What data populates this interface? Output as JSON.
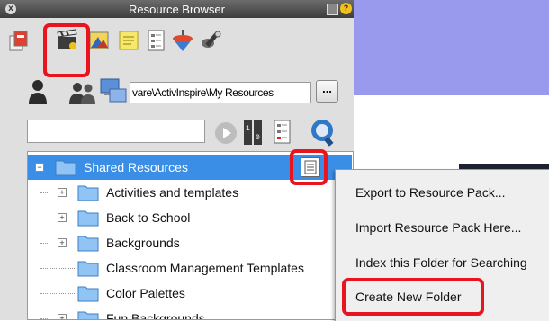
{
  "window": {
    "title": "Resource Browser",
    "close_glyph": "x",
    "help_glyph": "?"
  },
  "colors": {
    "highlight_red": "#e8141e",
    "selection_blue": "#3a8ee6",
    "titlebar": "#4a4a4a",
    "background_purple": "#9999ee"
  },
  "toolbar": {
    "icons": [
      "resources-icon",
      "media-clapboard-icon",
      "backgrounds-icon",
      "notes-icon",
      "document-page-icon",
      "spinning-top-icon",
      "pointer-tools-icon"
    ],
    "selected_icon": "media-clapboard-icon"
  },
  "path": {
    "value": "vare\\ActivInspire\\My Resources",
    "browse_label": "..."
  },
  "search": {
    "value": ""
  },
  "tree": {
    "items": [
      {
        "label": "Shared Resources",
        "expander": "−",
        "selected": true
      },
      {
        "label": "Activities and templates",
        "expander": "+"
      },
      {
        "label": "Back to School",
        "expander": "+"
      },
      {
        "label": "Backgrounds",
        "expander": "+"
      },
      {
        "label": "Classroom Management Templates",
        "expander": ""
      },
      {
        "label": "Color Palettes",
        "expander": ""
      },
      {
        "label": "Fun Backgrounds",
        "expander": "+"
      }
    ]
  },
  "context_menu": {
    "items": [
      "Export to Resource Pack...",
      "Import Resource Pack Here...",
      "Index this Folder for Searching",
      "Create New Folder"
    ],
    "highlighted_item": "Create New Folder"
  }
}
